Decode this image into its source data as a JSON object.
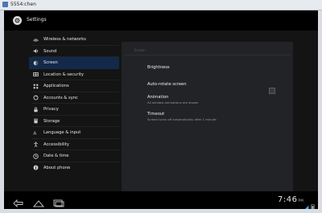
{
  "window": {
    "title": "5554:chen"
  },
  "app": {
    "title": "Settings"
  },
  "sidebar": {
    "items": [
      {
        "label": "Wireless & networks",
        "icon": "wireless-icon"
      },
      {
        "label": "Sound",
        "icon": "speaker-icon"
      },
      {
        "label": "Screen",
        "icon": "screen-icon",
        "selected": true
      },
      {
        "label": "Location & security",
        "icon": "location-icon"
      },
      {
        "label": "Applications",
        "icon": "apps-icon"
      },
      {
        "label": "Accounts & sync",
        "icon": "sync-icon"
      },
      {
        "label": "Privacy",
        "icon": "privacy-icon"
      },
      {
        "label": "Storage",
        "icon": "storage-icon"
      },
      {
        "label": "Language & input",
        "icon": "language-icon"
      },
      {
        "label": "Accessibility",
        "icon": "accessibility-icon"
      },
      {
        "label": "Date & time",
        "icon": "clock-icon"
      },
      {
        "label": "About phone",
        "icon": "info-icon"
      }
    ]
  },
  "detail": {
    "header": "Screen",
    "prefs": {
      "brightness": {
        "title": "Brightness"
      },
      "autorotate": {
        "title": "Auto-rotate screen",
        "checked": false
      },
      "animation": {
        "title": "Animation",
        "summary": "All window animations are shown"
      },
      "timeout": {
        "title": "Timeout",
        "summary": "Screen turns off automatically after 1 minute"
      }
    }
  },
  "statusbar": {
    "time": "7:46",
    "ampm": "PM"
  },
  "colors": {
    "selected": "#13294a",
    "panel": "#222326",
    "background": "#141414",
    "accent": "#33b5e5"
  }
}
